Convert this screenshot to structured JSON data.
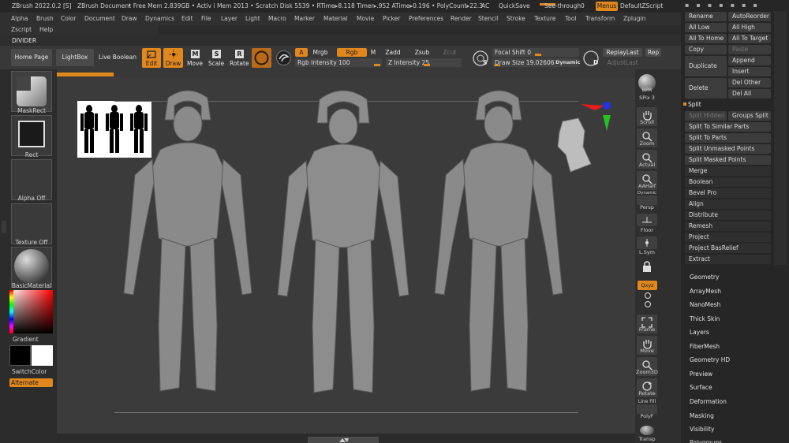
{
  "title": {
    "app": "ZBrush 2022.0.2 [S]",
    "document": "ZBrush Document",
    "stats": "• Free Mem 2.839GB • Activ i Mem 2013 • Scratch Disk 5539 • RTime▸8.118 Timer▸.952 ATime▸0.196 • PolyCount▸22.3",
    "ac": "AC",
    "quicksave": "QuickSave",
    "seethrough": "See-through",
    "seethrough_value": "0",
    "menus": "Menus",
    "defaultzscript": "DefaultZScript"
  },
  "menus": [
    "Alpha",
    "Brush",
    "Color",
    "Document",
    "Draw",
    "Dynamics",
    "Edit",
    "File",
    "Layer",
    "Light",
    "Macro",
    "Marker",
    "Material",
    "Movie",
    "Picker",
    "Preferences",
    "Render",
    "Stencil",
    "Stroke",
    "Texture",
    "Tool",
    "Transform",
    "Zplugin"
  ],
  "menus2": [
    "Zscript",
    "Help"
  ],
  "divider": "DIVIDER",
  "toolbar": {
    "home": "Home Page",
    "lightbox": "LightBox",
    "liveboolean": "Live Boolean",
    "edit": "Edit",
    "draw": "Draw",
    "move": "Move",
    "scale": "Scale",
    "rotate": "Rotate",
    "a": "A",
    "mrgb": "Mrgb",
    "rgb": "Rgb",
    "m": "M",
    "zadd": "Zadd",
    "zsub": "Zsub",
    "zcut": "Zcut",
    "rgb_intensity": "Rgb Intensity 100",
    "z_intensity": "Z Intensity 25",
    "focal_shift": "Focal Shift 0",
    "draw_size": "Draw Size 19.02606",
    "dynamic": "Dynamic",
    "replaylast": "ReplayLast",
    "rep": "Rep",
    "adjustlast": "AdjustLast",
    "s": "S",
    "d": "D"
  },
  "left": {
    "maskrect": "MaskRect",
    "rect": "Rect",
    "alphaoff": "Alpha Off",
    "textureoff": "Texture Off",
    "basicmaterial": "BasicMaterial",
    "gradient": "Gradient",
    "switchcolor": "SwitchColor",
    "alternate": "Alternate"
  },
  "right": {
    "bpr": "BPR",
    "spix": "SPix",
    "spix_value": "3",
    "scroll": "Scroll",
    "zoom": "Zoom",
    "actual": "Actual",
    "aahalf": "AAHalf",
    "dynamic": "Dynamic",
    "persp": "Persp",
    "floor": "Floor",
    "lsym": "L.Sym",
    "xyz": "Qxyz",
    "frame": "Frame",
    "move": "Move",
    "zoom3d": "Zoom3D",
    "rotate": "Rotate",
    "linefill": "Line Fill",
    "polyf": "PolyF",
    "transp": "Transp"
  },
  "panel": {
    "rename": "Rename",
    "autoreorder": "AutoReorder",
    "alllow": "All Low",
    "allhigh": "All High",
    "alltohome": "All To Home",
    "alltotarget": "All To Target",
    "copy": "Copy",
    "paste": "Paste",
    "duplicate": "Duplicate",
    "append": "Append",
    "insert": "Insert",
    "delete": "Delete",
    "delother": "Del Other",
    "delall": "Del All",
    "split": "Split",
    "splithidden": "Split Hidden",
    "groupssplit": "Groups Split",
    "splittosimilar": "Split To Similar Parts",
    "splittoparts": "Split To Parts",
    "splitunmasked": "Split Unmasked Points",
    "splitmasked": "Split Masked Points",
    "merge": "Merge",
    "boolean": "Boolean",
    "bevelpro": "Bevel Pro",
    "align": "Align",
    "distribute": "Distribute",
    "remesh": "Remesh",
    "project": "Project",
    "projectbasrelief": "Project BasRelief",
    "extract": "Extract",
    "sections": [
      "Geometry",
      "ArrayMesh",
      "NanoMesh",
      "Thick Skin",
      "Layers",
      "FiberMesh",
      "Geometry HD",
      "Preview",
      "Surface",
      "Deformation",
      "Masking",
      "Visibility",
      "Polygroups"
    ]
  },
  "colors": {
    "accent": "#e0881e",
    "bg": "#3b3b3b"
  }
}
